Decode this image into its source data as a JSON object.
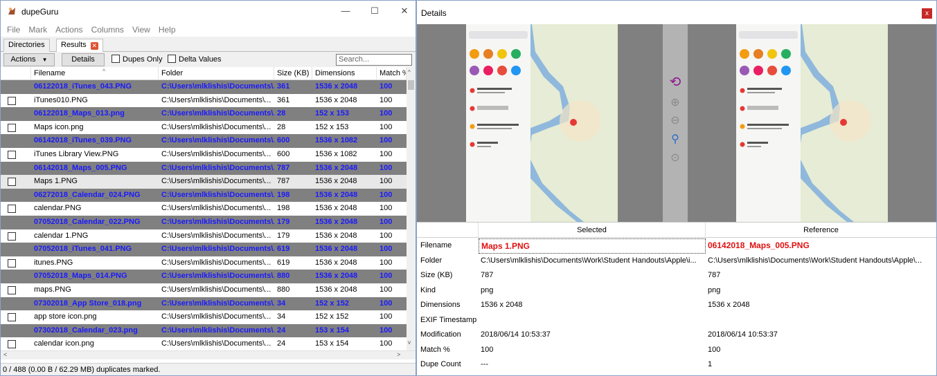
{
  "app": {
    "title": "dupeGuru",
    "window_buttons": [
      "—",
      "☐",
      "✕"
    ]
  },
  "menu": [
    "File",
    "Mark",
    "Actions",
    "Columns",
    "View",
    "Help"
  ],
  "tabs": [
    {
      "label": "Directories"
    },
    {
      "label": "Results",
      "close": "✕"
    }
  ],
  "toolbar": {
    "actions_label": "Actions",
    "actions_arrow": "▼",
    "details_label": "Details",
    "dupes_only_label": "Dupes Only",
    "delta_values_label": "Delta Values",
    "search_placeholder": "Search..."
  },
  "columns": [
    "Filename",
    "Folder",
    "Size (KB)",
    "Dimensions",
    "Match %"
  ],
  "rows": [
    {
      "type": "ref",
      "filename": "06122018_iTunes_043.PNG",
      "folder": "C:\\Users\\mlklishis\\Documents\\...",
      "size": "361",
      "dimensions": "1536 x 2048",
      "match": "100"
    },
    {
      "type": "dupe",
      "filename": "iTunes010.PNG",
      "folder": "C:\\Users\\mlklishis\\Documents\\...",
      "size": "361",
      "dimensions": "1536 x 2048",
      "match": "100"
    },
    {
      "type": "ref",
      "filename": "06122018_Maps_013.png",
      "folder": "C:\\Users\\mlklishis\\Documents\\...",
      "size": "28",
      "dimensions": "152 x 153",
      "match": "100"
    },
    {
      "type": "dupe",
      "filename": "Maps icon.png",
      "folder": "C:\\Users\\mlklishis\\Documents\\...",
      "size": "28",
      "dimensions": "152 x 153",
      "match": "100"
    },
    {
      "type": "ref",
      "filename": "06142018_iTunes_039.PNG",
      "folder": "C:\\Users\\mlklishis\\Documents\\...",
      "size": "600",
      "dimensions": "1536 x 1082",
      "match": "100"
    },
    {
      "type": "dupe",
      "filename": "iTunes Library View.PNG",
      "folder": "C:\\Users\\mlklishis\\Documents\\...",
      "size": "600",
      "dimensions": "1536 x 1082",
      "match": "100"
    },
    {
      "type": "ref",
      "filename": "06142018_Maps_005.PNG",
      "folder": "C:\\Users\\mlklishis\\Documents\\...",
      "size": "787",
      "dimensions": "1536 x 2048",
      "match": "100"
    },
    {
      "type": "sel",
      "filename": "Maps 1.PNG",
      "folder": "C:\\Users\\mlklishis\\Documents\\...",
      "size": "787",
      "dimensions": "1536 x 2048",
      "match": "100"
    },
    {
      "type": "ref",
      "filename": "06272018_Calendar_024.PNG",
      "folder": "C:\\Users\\mlklishis\\Documents\\...",
      "size": "198",
      "dimensions": "1536 x 2048",
      "match": "100"
    },
    {
      "type": "dupe",
      "filename": "calendar.PNG",
      "folder": "C:\\Users\\mlklishis\\Documents\\...",
      "size": "198",
      "dimensions": "1536 x 2048",
      "match": "100"
    },
    {
      "type": "ref",
      "filename": "07052018_Calendar_022.PNG",
      "folder": "C:\\Users\\mlklishis\\Documents\\...",
      "size": "179",
      "dimensions": "1536 x 2048",
      "match": "100"
    },
    {
      "type": "dupe",
      "filename": "calendar 1.PNG",
      "folder": "C:\\Users\\mlklishis\\Documents\\...",
      "size": "179",
      "dimensions": "1536 x 2048",
      "match": "100"
    },
    {
      "type": "ref",
      "filename": "07052018_iTunes_041.PNG",
      "folder": "C:\\Users\\mlklishis\\Documents\\...",
      "size": "619",
      "dimensions": "1536 x 2048",
      "match": "100"
    },
    {
      "type": "dupe",
      "filename": "itunes.PNG",
      "folder": "C:\\Users\\mlklishis\\Documents\\...",
      "size": "619",
      "dimensions": "1536 x 2048",
      "match": "100"
    },
    {
      "type": "ref",
      "filename": "07052018_Maps_014.PNG",
      "folder": "C:\\Users\\mlklishis\\Documents\\...",
      "size": "880",
      "dimensions": "1536 x 2048",
      "match": "100"
    },
    {
      "type": "dupe",
      "filename": "maps.PNG",
      "folder": "C:\\Users\\mlklishis\\Documents\\...",
      "size": "880",
      "dimensions": "1536 x 2048",
      "match": "100"
    },
    {
      "type": "ref",
      "filename": "07302018_App Store_018.png",
      "folder": "C:\\Users\\mlklishis\\Documents\\...",
      "size": "34",
      "dimensions": "152 x 152",
      "match": "100"
    },
    {
      "type": "dupe",
      "filename": "app store icon.png",
      "folder": "C:\\Users\\mlklishis\\Documents\\...",
      "size": "34",
      "dimensions": "152 x 152",
      "match": "100"
    },
    {
      "type": "ref",
      "filename": "07302018_Calendar_023.png",
      "folder": "C:\\Users\\mlklishis\\Documents\\...",
      "size": "24",
      "dimensions": "153 x 154",
      "match": "100"
    },
    {
      "type": "dupe",
      "filename": "calendar icon.png",
      "folder": "C:\\Users\\mlklishis\\Documents\\...",
      "size": "24",
      "dimensions": "153 x 154",
      "match": "100"
    }
  ],
  "status": "0 / 488 (0.00 B / 62.29 MB) duplicates marked.",
  "details": {
    "title": "Details",
    "close": "x",
    "col_selected": "Selected",
    "col_reference": "Reference",
    "rows": [
      {
        "label": "Filename",
        "selected": "Maps 1.PNG",
        "reference": "06142018_Maps_005.PNG"
      },
      {
        "label": "Folder",
        "selected": "C:\\Users\\mlklishis\\Documents\\Work\\Student Handouts\\Apple\\i...",
        "reference": "C:\\Users\\mlklishis\\Documents\\Work\\Student Handouts\\Apple\\..."
      },
      {
        "label": "Size (KB)",
        "selected": "787",
        "reference": "787"
      },
      {
        "label": "Kind",
        "selected": "png",
        "reference": "png"
      },
      {
        "label": "Dimensions",
        "selected": "1536 x 2048",
        "reference": "1536 x 2048"
      },
      {
        "label": "EXIF Timestamp",
        "selected": "",
        "reference": ""
      },
      {
        "label": "Modification",
        "selected": "2018/06/14 10:53:37",
        "reference": "2018/06/14 10:53:37"
      },
      {
        "label": "Match %",
        "selected": "100",
        "reference": "100"
      },
      {
        "label": "Dupe Count",
        "selected": "---",
        "reference": "1"
      }
    ]
  },
  "colors": {
    "ref_row_bg": "#808080",
    "ref_row_text": "#1a1aff",
    "highlight_red": "#e01010",
    "close_red": "#c62828"
  },
  "icons": [
    "app-logo-icon",
    "swap-images-icon",
    "zoom-in-icon",
    "zoom-out-icon",
    "zoom-normal-icon",
    "best-fit-icon",
    "scroll-up-icon",
    "scroll-down-icon",
    "scroll-left-icon",
    "scroll-right-icon"
  ]
}
